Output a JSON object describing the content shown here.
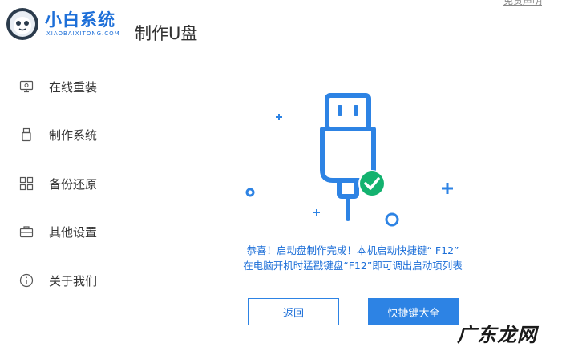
{
  "header": {
    "top_link": "免责声明",
    "brand_name": "小白系统",
    "brand_sub": "XIAOBAIXITONG.COM",
    "page_title": "制作U盘"
  },
  "sidebar": {
    "items": [
      {
        "label": "在线重装",
        "icon": "monitor-icon"
      },
      {
        "label": "制作系统",
        "icon": "usb-icon"
      },
      {
        "label": "备份还原",
        "icon": "grid-icon"
      },
      {
        "label": "其他设置",
        "icon": "toolbox-icon"
      },
      {
        "label": "关于我们",
        "icon": "info-icon"
      }
    ]
  },
  "main": {
    "message_line1": "恭喜！启动盘制作完成！本机启动快捷键“ F12”",
    "message_line2": "在电脑开机时猛戳键盘“F12”即可调出启动项列表",
    "back_button": "返回",
    "hotkey_button": "快捷键大全"
  },
  "watermark": "广东龙网",
  "colors": {
    "accent": "#2d83e4",
    "brand": "#1d6fd8",
    "success": "#13b26f"
  }
}
